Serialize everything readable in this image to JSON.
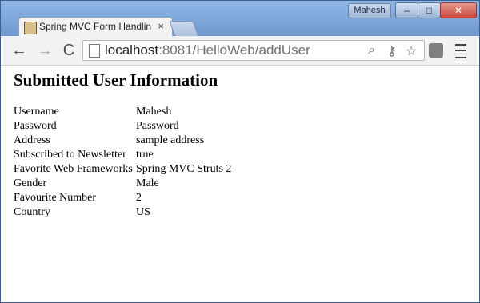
{
  "window": {
    "user": "Mahesh",
    "controls": {
      "minimize": "–",
      "maximize": "□",
      "close": "✕"
    }
  },
  "tab": {
    "title": "Spring MVC Form Handlin",
    "close_glyph": "×"
  },
  "toolbar": {
    "back_icon": "←",
    "forward_icon": "→",
    "reload_icon": "C",
    "address": {
      "host": "localhost",
      "path": ":8081/HelloWeb/addUser"
    },
    "icons": [
      "search-icon",
      "key-icon",
      "star-icon",
      "extension-icon",
      "menu-icon"
    ]
  },
  "page": {
    "title": "Submitted User Information",
    "rows": [
      {
        "label": "Username",
        "value": "Mahesh"
      },
      {
        "label": "Password",
        "value": "Password"
      },
      {
        "label": "Address",
        "value": "sample address"
      },
      {
        "label": "Subscribed to Newsletter",
        "value": "true"
      },
      {
        "label": "Favorite Web Frameworks",
        "value": "Spring MVC Struts 2"
      },
      {
        "label": "Gender",
        "value": "Male"
      },
      {
        "label": "Favourite Number",
        "value": "2"
      },
      {
        "label": "Country",
        "value": "US"
      }
    ]
  }
}
